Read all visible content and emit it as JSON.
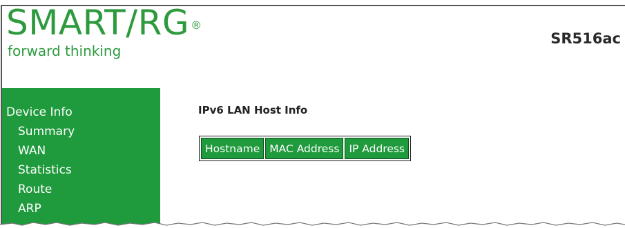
{
  "brand": {
    "name": "SMART/RG",
    "registered_mark": "®",
    "tagline": "forward thinking"
  },
  "header": {
    "model": "SR516ac"
  },
  "sidebar": {
    "items": [
      {
        "label": "Device Info"
      },
      {
        "label": "Summary"
      },
      {
        "label": "WAN"
      },
      {
        "label": "Statistics"
      },
      {
        "label": "Route"
      },
      {
        "label": "ARP"
      }
    ]
  },
  "main": {
    "title": "IPv6 LAN Host Info",
    "table": {
      "columns": [
        "Hostname",
        "MAC Address",
        "IP Address"
      ],
      "rows": []
    }
  },
  "colors": {
    "brand_green": "#2e9a3e",
    "sidebar_green": "#1f9a3c",
    "header_text": "#2a2a2a"
  }
}
